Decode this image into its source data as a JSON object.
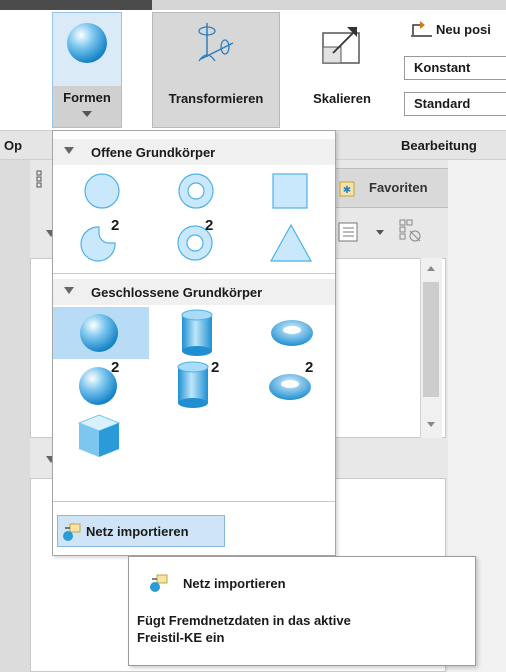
{
  "ribbon": {
    "formen_label": "Formen",
    "transformieren_label": "Transformieren",
    "skalieren_label": "Skalieren",
    "neu_positionieren_label": "Neu posi",
    "konstant_value": "Konstant",
    "standard_value": "Standard"
  },
  "groupbar": {
    "left_group_label": "Op",
    "bearbeitung_label": "Bearbeitung"
  },
  "panel": {
    "favoriten_label": "Favoriten"
  },
  "dropdown": {
    "section_open_title": "Offene Grundkörper",
    "section_closed_title": "Geschlossene Grundkörper",
    "superscript": "2",
    "import_label": "Netz importieren"
  },
  "tooltip": {
    "title": "Netz importieren",
    "description_line1": "Fügt Fremdnetzdaten in das aktive",
    "description_line2": "Freistil-KE ein"
  },
  "colors": {
    "selection_blue": "#b9dcf6",
    "shape_light": "#c9e8fb",
    "shape_dark": "#2a9bd8"
  }
}
